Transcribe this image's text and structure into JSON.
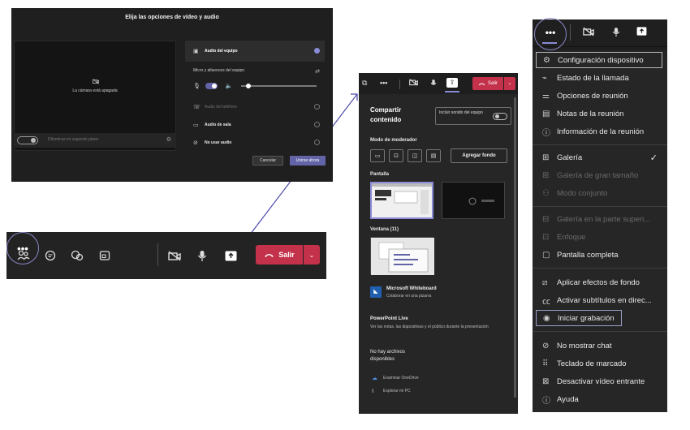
{
  "device_settings": {
    "title": "Elija las opciones de vídeo y audio",
    "camera_off_text": "La cámara está apagada",
    "blur_text": "Difuminar mi segundo plano",
    "audio_options": [
      {
        "label": "Audio del equipo",
        "selected": true
      },
      {
        "label": "Micro y altavoces del equipo"
      },
      {
        "label": "Audio del teléfono",
        "disabled": true
      },
      {
        "label": "Audio de sala"
      },
      {
        "label": "No usar audio"
      }
    ],
    "cancel_label": "Cancelar",
    "join_label": "Unirse ahora",
    "accent": "#6264a7"
  },
  "toolbar": {
    "more_label": "•••",
    "leave_label": "Salir",
    "leave_color": "#c4314b"
  },
  "share": {
    "leave_label": "Salir",
    "heading": "Compartir contenido",
    "include_sound": "Incluir sonido del equipo",
    "presenter_mode": "Modo de moderador",
    "add_background": "Agregar fondo",
    "screen_label": "Pantalla",
    "window_label": "Ventana (11)",
    "whiteboard_title": "Microsoft Whiteboard",
    "whiteboard_sub": "Colaborar en una pizarra",
    "ppt_title": "PowerPoint Live",
    "ppt_desc": "Ver las notas, las diapositivas y el público durante la presentación",
    "no_files": "No hay archivos disponibles",
    "browse_onedrive": "Examinar OneDrive",
    "browse_pc": "Explorar mi PC"
  },
  "menu": {
    "more_label": "•••",
    "items": [
      {
        "label": "Configuración dispositivo",
        "icon": "gear-icon"
      },
      {
        "label": "Estado de la llamada",
        "icon": "pulse-icon"
      },
      {
        "label": "Opciones de reunión",
        "icon": "sliders-icon"
      },
      {
        "label": "Notas de la reunión",
        "icon": "notes-icon"
      },
      {
        "label": "Información de la reunión",
        "icon": "info-icon"
      },
      {
        "label": "Galería",
        "icon": "grid-icon"
      },
      {
        "label": "Galería de gran tamaño",
        "icon": "grid-large-icon"
      },
      {
        "label": "Modo conjunto",
        "icon": "together-icon"
      },
      {
        "label": "Galería en la parte superi...",
        "icon": "gallery-top-icon"
      },
      {
        "label": "Enfoque",
        "icon": "focus-icon"
      },
      {
        "label": "Pantalla completa",
        "icon": "fullscreen-icon"
      },
      {
        "label": "Aplicar efectos de fondo",
        "icon": "background-icon"
      },
      {
        "label": "Activar subtítulos en direc...",
        "icon": "captions-icon"
      },
      {
        "label": "Iniciar grabación",
        "icon": "record-icon"
      },
      {
        "label": "No mostrar chat",
        "icon": "no-chat-icon"
      },
      {
        "label": "Teclado de marcado",
        "icon": "dialpad-icon"
      },
      {
        "label": "Desactivar vídeo entrante",
        "icon": "video-off-icon"
      },
      {
        "label": "Ayuda",
        "icon": "help-icon"
      }
    ]
  }
}
